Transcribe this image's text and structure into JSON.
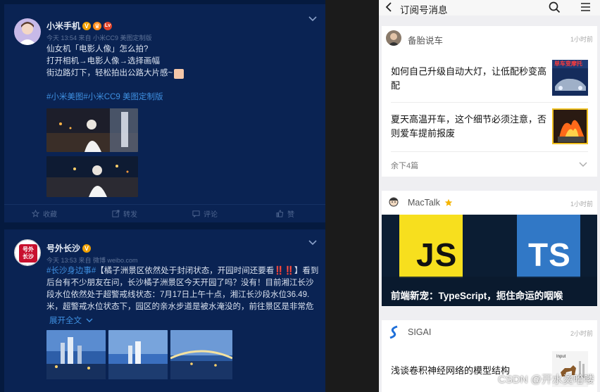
{
  "weibo": {
    "posts": [
      {
        "username": "小米手机",
        "meta": "今天 13:54 来自 小米CC9 美图定制版",
        "lines": [
          "仙女机「电影人像」怎么拍?",
          "打开相机→电影人像→选择画幅",
          "街边路灯下，轻松拍出公路大片感~"
        ],
        "hashtags": "#小米美图#",
        "hashtag_suffix": "小米CC9 美图定制版",
        "actions": [
          "收藏",
          "转发",
          "评论",
          "赞"
        ]
      },
      {
        "username": "号外长沙",
        "avatar_text": "号外长沙",
        "meta": "今天 13:53 来自 微博 weibo.com",
        "hashtag": "#长沙身边事#",
        "text": "【橘子洲景区依然处于封闭状态，开园时间还要看‼️‼️】看到后台有不少朋友在问，长沙橘子洲景区今天开园了吗？没有！目前湘江长沙段水位依然处于超警戒线状态：7月17日上午十点，湘江长沙段水位36.49.米，超警戒水位状态下，园区的亲水步道是被水淹没的，前往景区是非常危险，故景 ...",
        "expand": "展开全文"
      }
    ]
  },
  "subs": {
    "title": "订阅号消息",
    "accounts": [
      {
        "name": "备胎说车",
        "time": "1小时前",
        "articles": [
          {
            "title": "如何自己升级自动大灯，让低配秒变高配",
            "thumb_caption": "单车变摩托"
          },
          {
            "title": "夏天高温开车，这个细节必须注意，否则爱车提前报废"
          }
        ],
        "more": "余下4篇"
      },
      {
        "name": "MacTalk",
        "time": "1小时前",
        "banner_left": "JS",
        "banner_right": "TS",
        "banner_caption": "前端新宠：TypeScript，扼住命运的咽喉"
      },
      {
        "name": "SIGAI",
        "time": "2小时前",
        "article": "浅谈卷积神经网络的模型结构",
        "thumb_caption": "Input"
      }
    ],
    "watermark": "CSDN @开水烫哈喽"
  },
  "colors": {
    "weibo_bg": "#051a3f",
    "weibo_card": "#0a2353",
    "hashtag": "#3e8fe0",
    "js_yellow": "#f7df1e",
    "ts_blue": "#3178c6"
  }
}
